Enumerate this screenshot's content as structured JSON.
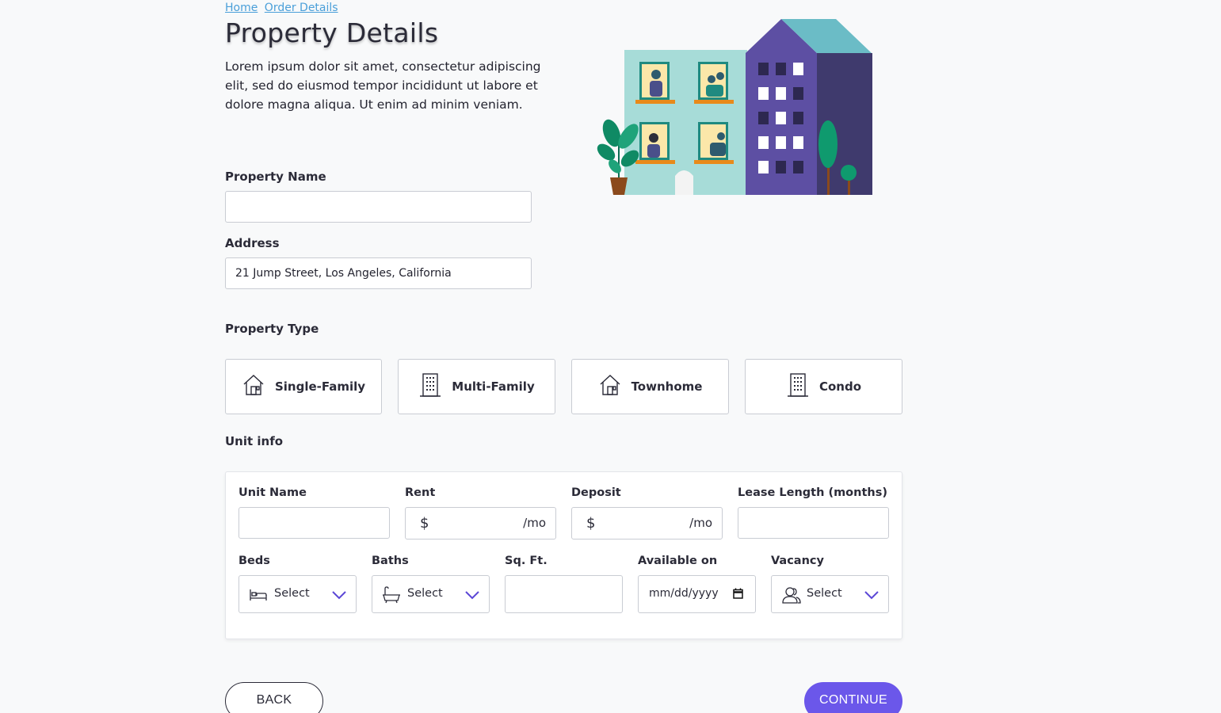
{
  "breadcrumb": {
    "home": "Home",
    "order_details": "Order Details"
  },
  "page": {
    "title": "Property Details",
    "intro": "Lorem ipsum dolor sit amet, consectetur adipiscing elit, sed do eiusmod tempor incididunt ut labore et dolore magna aliqua. Ut enim ad minim veniam."
  },
  "form": {
    "property_name": {
      "label": "Property Name",
      "value": ""
    },
    "address": {
      "label": "Address",
      "value": "21 Jump Street, Los Angeles, California"
    }
  },
  "property_type": {
    "label": "Property Type",
    "options": [
      {
        "label": "Single-Family",
        "icon": "house-icon"
      },
      {
        "label": "Multi-Family",
        "icon": "building-icon"
      },
      {
        "label": "Townhome",
        "icon": "house-icon"
      },
      {
        "label": "Condo",
        "icon": "building-icon"
      }
    ]
  },
  "unit_info": {
    "label": "Unit info",
    "unit_name": {
      "label": "Unit Name",
      "value": ""
    },
    "rent": {
      "label": "Rent",
      "prefix": "$",
      "suffix": "/mo",
      "value": ""
    },
    "deposit": {
      "label": "Deposit",
      "prefix": "$",
      "suffix": "/mo",
      "value": ""
    },
    "lease_length": {
      "label": "Lease Length (months)",
      "value": ""
    },
    "beds": {
      "label": "Beds",
      "value": "Select",
      "icon": "bed-icon"
    },
    "baths": {
      "label": "Baths",
      "value": "Select",
      "icon": "bathtub-icon"
    },
    "sqft": {
      "label": "Sq. Ft.",
      "value": ""
    },
    "available_on": {
      "label": "Available on",
      "placeholder": "mm/dd/yyyy",
      "icon": "calendar-icon"
    },
    "vacancy": {
      "label": "Vacancy",
      "value": "Select",
      "icon": "users-icon"
    }
  },
  "actions": {
    "back": "BACK",
    "continue": "CONTINUE"
  },
  "colors": {
    "accent": "#6b57ea",
    "link": "#4a9fd9",
    "text": "#2b2b38",
    "border": "#c9ccd3"
  }
}
